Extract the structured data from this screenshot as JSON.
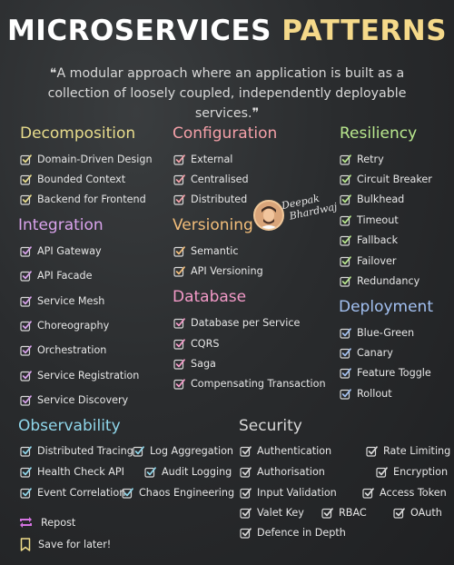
{
  "title": {
    "part1": "MICROSERVICES",
    "part2": "PATTERNS"
  },
  "subtitle": "❝A modular approach where an application is built as a collection of loosely coupled, independently deployable services.❞",
  "author": {
    "signature_line1": "Deepak",
    "signature_line2": "Bhardwaj"
  },
  "sections": {
    "decomposition": {
      "title": "Decomposition",
      "color": "#e8dc8c",
      "items": [
        "Domain-Driven Design",
        "Bounded Context",
        "Backend for Frontend"
      ]
    },
    "integration": {
      "title": "Integration",
      "color": "#d9a3ec",
      "items": [
        "API Gateway",
        "API Facade",
        "Service Mesh",
        "Choreography",
        "Orchestration",
        "Service Registration",
        "Service Discovery"
      ]
    },
    "configuration": {
      "title": "Configuration",
      "color": "#f4a0a8",
      "items": [
        "External",
        "Centralised",
        "Distributed"
      ]
    },
    "versioning": {
      "title": "Versioning",
      "color": "#f3be7a",
      "items": [
        "Semantic",
        "API Versioning"
      ]
    },
    "database": {
      "title": "Database",
      "color": "#f39ac8",
      "items": [
        "Database per Service",
        "CQRS",
        "Saga",
        "Compensating Transaction"
      ]
    },
    "resiliency": {
      "title": "Resiliency",
      "color": "#b9e88e",
      "items": [
        "Retry",
        "Circuit Breaker",
        "Bulkhead",
        "Timeout",
        "Fallback",
        "Failover",
        "Redundancy"
      ]
    },
    "deployment": {
      "title": "Deployment",
      "color": "#a3c1f2",
      "items": [
        "Blue-Green",
        "Canary",
        "Feature Toggle",
        "Rollout"
      ]
    },
    "observability": {
      "title": "Observability",
      "color": "#8fd6ea",
      "items": [
        "Distributed Tracing",
        "Log Aggregation",
        "Health Check API",
        "Audit Logging",
        "Event Correlation",
        "Chaos Engineering"
      ]
    },
    "security": {
      "title": "Security",
      "color": "#d8d8d8",
      "items": [
        "Authentication",
        "Rate Limiting",
        "Authorisation",
        "Encryption",
        "Input Validation",
        "Access Token",
        "Valet Key",
        "RBAC",
        "OAuth",
        "Defence in Depth"
      ]
    }
  },
  "footer": {
    "repost": "Repost",
    "save": "Save for later!"
  },
  "colors": {
    "check_box": "#d7d7d7",
    "repost_icon": "#d473e0",
    "bookmark_icon": "#f0dc8a",
    "title_accent": "#f5d98a"
  }
}
